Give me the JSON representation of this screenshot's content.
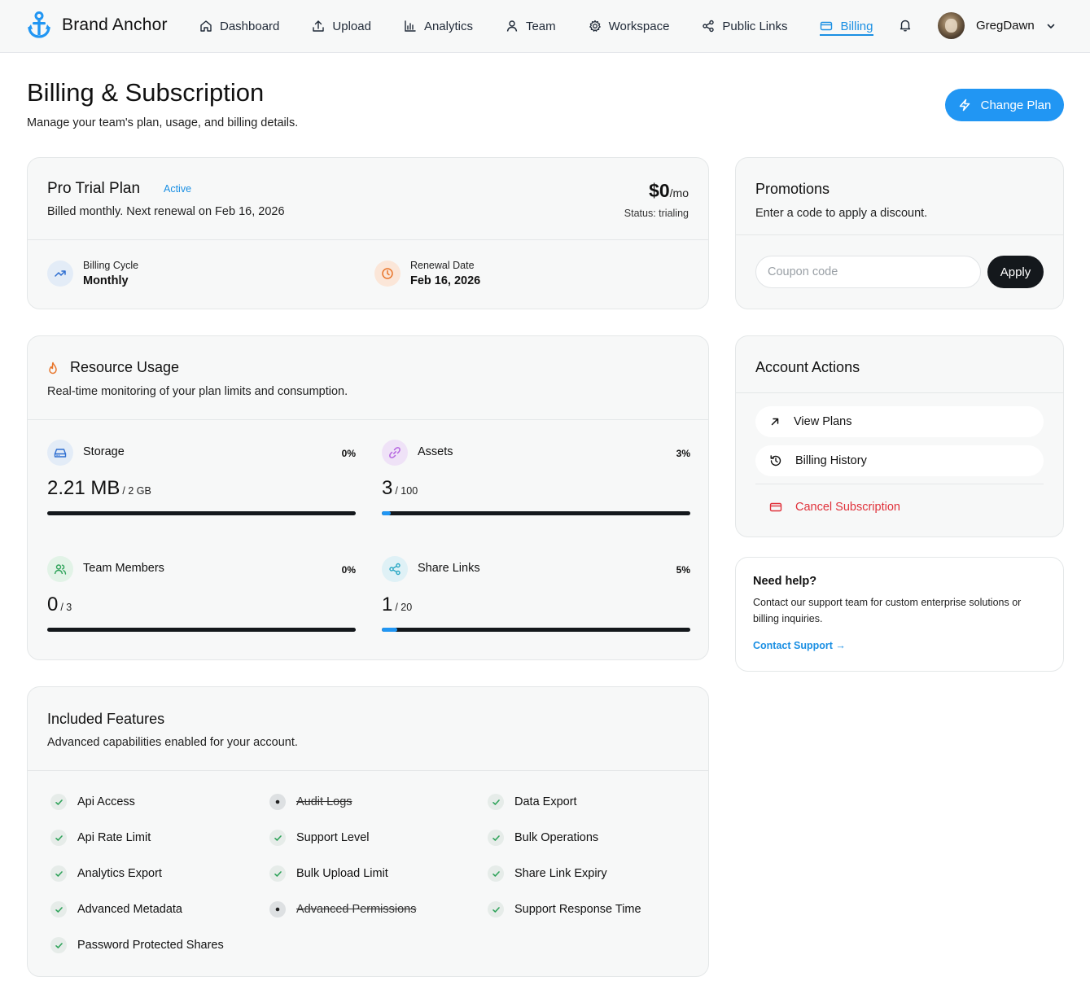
{
  "brand": {
    "name": "Brand Anchor"
  },
  "nav": {
    "items": [
      {
        "label": "Dashboard",
        "icon": "home-icon"
      },
      {
        "label": "Upload",
        "icon": "upload-icon"
      },
      {
        "label": "Analytics",
        "icon": "bar-chart-icon"
      },
      {
        "label": "Team",
        "icon": "user-icon"
      },
      {
        "label": "Workspace",
        "icon": "gear-icon"
      },
      {
        "label": "Public Links",
        "icon": "share-icon"
      },
      {
        "label": "Billing",
        "icon": "credit-card-icon",
        "active": true
      }
    ],
    "username": "GregDawn"
  },
  "header": {
    "title": "Billing & Subscription",
    "subtitle": "Manage your team's plan, usage, and billing details.",
    "change_plan_label": "Change Plan"
  },
  "plan": {
    "name": "Pro Trial Plan",
    "badge": "Active",
    "renewal_text": "Billed monthly. Next renewal on Feb 16, 2026",
    "price": "$0",
    "price_unit": "/mo",
    "status": "Status: trialing",
    "billing_cycle_label": "Billing Cycle",
    "billing_cycle_value": "Monthly",
    "renewal_date_label": "Renewal Date",
    "renewal_date_value": "Feb 16, 2026"
  },
  "promotions": {
    "title": "Promotions",
    "subtitle": "Enter a code to apply a discount.",
    "coupon_placeholder": "Coupon code",
    "apply_label": "Apply"
  },
  "usage": {
    "title": "Resource Usage",
    "subtitle": "Real-time monitoring of your plan limits and consumption.",
    "items": [
      {
        "label": "Storage",
        "percent": "0%",
        "value": "2.21 MB",
        "limit": "/ 2 GB",
        "fill": 0
      },
      {
        "label": "Assets",
        "percent": "3%",
        "value": "3",
        "limit": "/ 100",
        "fill": 0.03
      },
      {
        "label": "Team Members",
        "percent": "0%",
        "value": "0",
        "limit": "/ 3",
        "fill": 0
      },
      {
        "label": "Share Links",
        "percent": "5%",
        "value": "1",
        "limit": "/ 20",
        "fill": 0.05
      }
    ]
  },
  "actions": {
    "title": "Account Actions",
    "view_plans": "View Plans",
    "billing_history": "Billing History",
    "cancel": "Cancel Subscription"
  },
  "help": {
    "title": "Need help?",
    "text": "Contact our support team for custom enterprise solutions or billing inquiries.",
    "link": "Contact Support →"
  },
  "features": {
    "title": "Included Features",
    "subtitle": "Advanced capabilities enabled for your account.",
    "items": [
      {
        "label": "Api Access",
        "enabled": true
      },
      {
        "label": "Audit Logs",
        "enabled": false
      },
      {
        "label": "Data Export",
        "enabled": true
      },
      {
        "label": "Api Rate Limit",
        "enabled": true
      },
      {
        "label": "Support Level",
        "enabled": true
      },
      {
        "label": "Bulk Operations",
        "enabled": true
      },
      {
        "label": "Analytics Export",
        "enabled": true
      },
      {
        "label": "Bulk Upload Limit",
        "enabled": true
      },
      {
        "label": "Share Link Expiry",
        "enabled": true
      },
      {
        "label": "Advanced Metadata",
        "enabled": true
      },
      {
        "label": "Advanced Permissions",
        "enabled": false
      },
      {
        "label": "Support Response Time",
        "enabled": true
      },
      {
        "label": "Password Protected Shares",
        "enabled": true
      }
    ]
  },
  "colors": {
    "accent": "#2196f3",
    "danger": "#e0313a",
    "dark": "#14181c"
  }
}
